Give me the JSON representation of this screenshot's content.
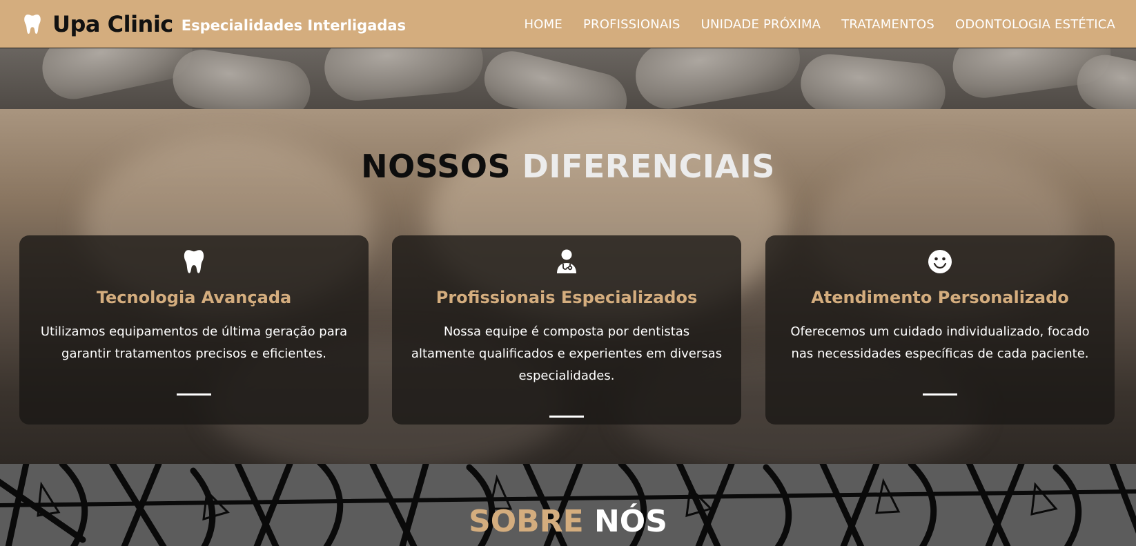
{
  "header": {
    "brand_name": "Upa Clinic",
    "tagline": "Especialidades Interligadas",
    "nav": [
      "HOME",
      "PROFISSIONAIS",
      "UNIDADE PRÓXIMA",
      "TRATAMENTOS",
      "ODONTOLOGIA ESTÉTICA"
    ]
  },
  "features": {
    "title_part1": "NOSSOS",
    "title_part2": "DIFERENCIAIS",
    "cards": [
      {
        "icon": "tooth-icon",
        "title": "Tecnologia Avançada",
        "text": "Utilizamos equipamentos de última geração para garantir tratamentos precisos e eficientes."
      },
      {
        "icon": "doctor-icon",
        "title": "Profissionais Especializados",
        "text": "Nossa equipe é composta por dentistas altamente qualificados e experientes em diversas especialidades."
      },
      {
        "icon": "smile-icon",
        "title": "Atendimento Personalizado",
        "text": "Oferecemos um cuidado individualizado, focado nas necessidades específicas de cada paciente."
      }
    ]
  },
  "about": {
    "title_part1": "SOBRE",
    "title_part2": "NÓS"
  },
  "colors": {
    "accent": "#d4ad7e",
    "card_bg": "#1a1715",
    "title_dark": "#0d0d0d"
  }
}
